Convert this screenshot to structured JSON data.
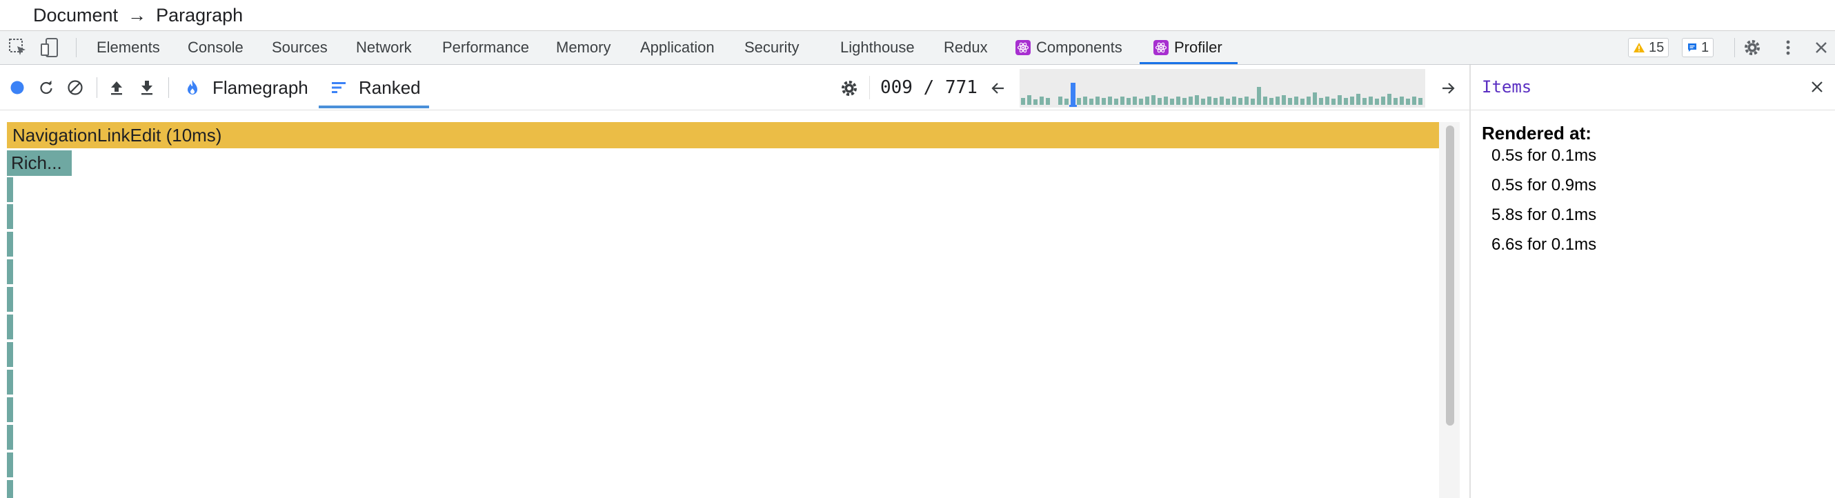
{
  "breadcrumb": {
    "first": "Document",
    "second": "Paragraph"
  },
  "tabs": [
    {
      "label": "Elements"
    },
    {
      "label": "Console"
    },
    {
      "label": "Sources"
    },
    {
      "label": "Network"
    },
    {
      "label": "Performance"
    },
    {
      "label": "Memory"
    },
    {
      "label": "Application"
    },
    {
      "label": "Security"
    },
    {
      "label": "Lighthouse"
    },
    {
      "label": "Redux"
    },
    {
      "label": "Components"
    },
    {
      "label": "Profiler"
    }
  ],
  "active_tab": "Profiler",
  "badges": {
    "warnings": "15",
    "messages": "1"
  },
  "colors": {
    "accent": "#1a73e8",
    "flame_yellow": "#ebbd46",
    "flame_teal": "#6fa8a2",
    "react": "#a72fd0",
    "warning": "#f4b400"
  },
  "profiler": {
    "flamegraph_label": "Flamegraph",
    "ranked_label": "Ranked",
    "view_selected": "Ranked",
    "commit_current": "009",
    "commit_total": "771",
    "commit_separator": " / "
  },
  "chart": {
    "main_bar": "NavigationLinkEdit (10ms)",
    "second_bar": "Rich..."
  },
  "sidebar": {
    "title": "Items",
    "rendered_label": "Rendered at:",
    "renders": [
      "0.5s for 0.1ms",
      "0.5s for 0.9ms",
      "5.8s for 0.1ms",
      "6.6s for 0.1ms"
    ]
  }
}
